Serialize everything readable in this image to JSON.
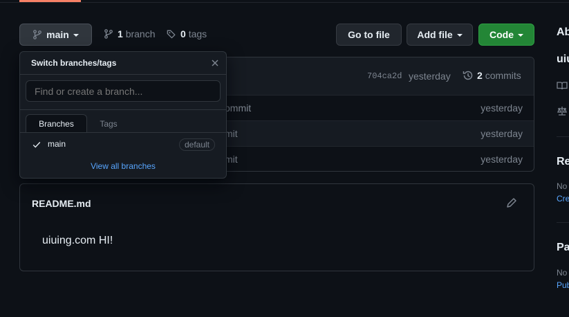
{
  "branch_button": {
    "label": "main"
  },
  "stats": {
    "branches_count": "1",
    "branches_label": "branch",
    "tags_count": "0",
    "tags_label": "tags"
  },
  "actions": {
    "goto_file": "Go to file",
    "add_file": "Add file",
    "code": "Code"
  },
  "commit_bar": {
    "hash": "704ca2d",
    "time": "yesterday",
    "commits_count": "2",
    "commits_label": "commits"
  },
  "files": [
    {
      "message": "ommit",
      "time": "yesterday"
    },
    {
      "message": "mit",
      "time": "yesterday"
    },
    {
      "message": "mit",
      "time": "yesterday"
    }
  ],
  "dropdown": {
    "title": "Switch branches/tags",
    "search_placeholder": "Find or create a branch...",
    "tabs": [
      "Branches",
      "Tags"
    ],
    "branch": {
      "name": "main",
      "badge": "default"
    },
    "view_all": "View all branches"
  },
  "readme": {
    "filename": "README.md",
    "content": "uiuing.com HI!"
  },
  "sidebar": {
    "about": "Ab",
    "desc": "uiu",
    "releases_heading": "Re",
    "releases_text": "No",
    "releases_link": "Cre",
    "packages_heading": "Pa",
    "packages_text": "No",
    "packages_link": "Pub"
  },
  "colors": {
    "bg": "#0d1117",
    "primary": "#238636",
    "link": "#58a6ff",
    "accent": "#f78166"
  }
}
